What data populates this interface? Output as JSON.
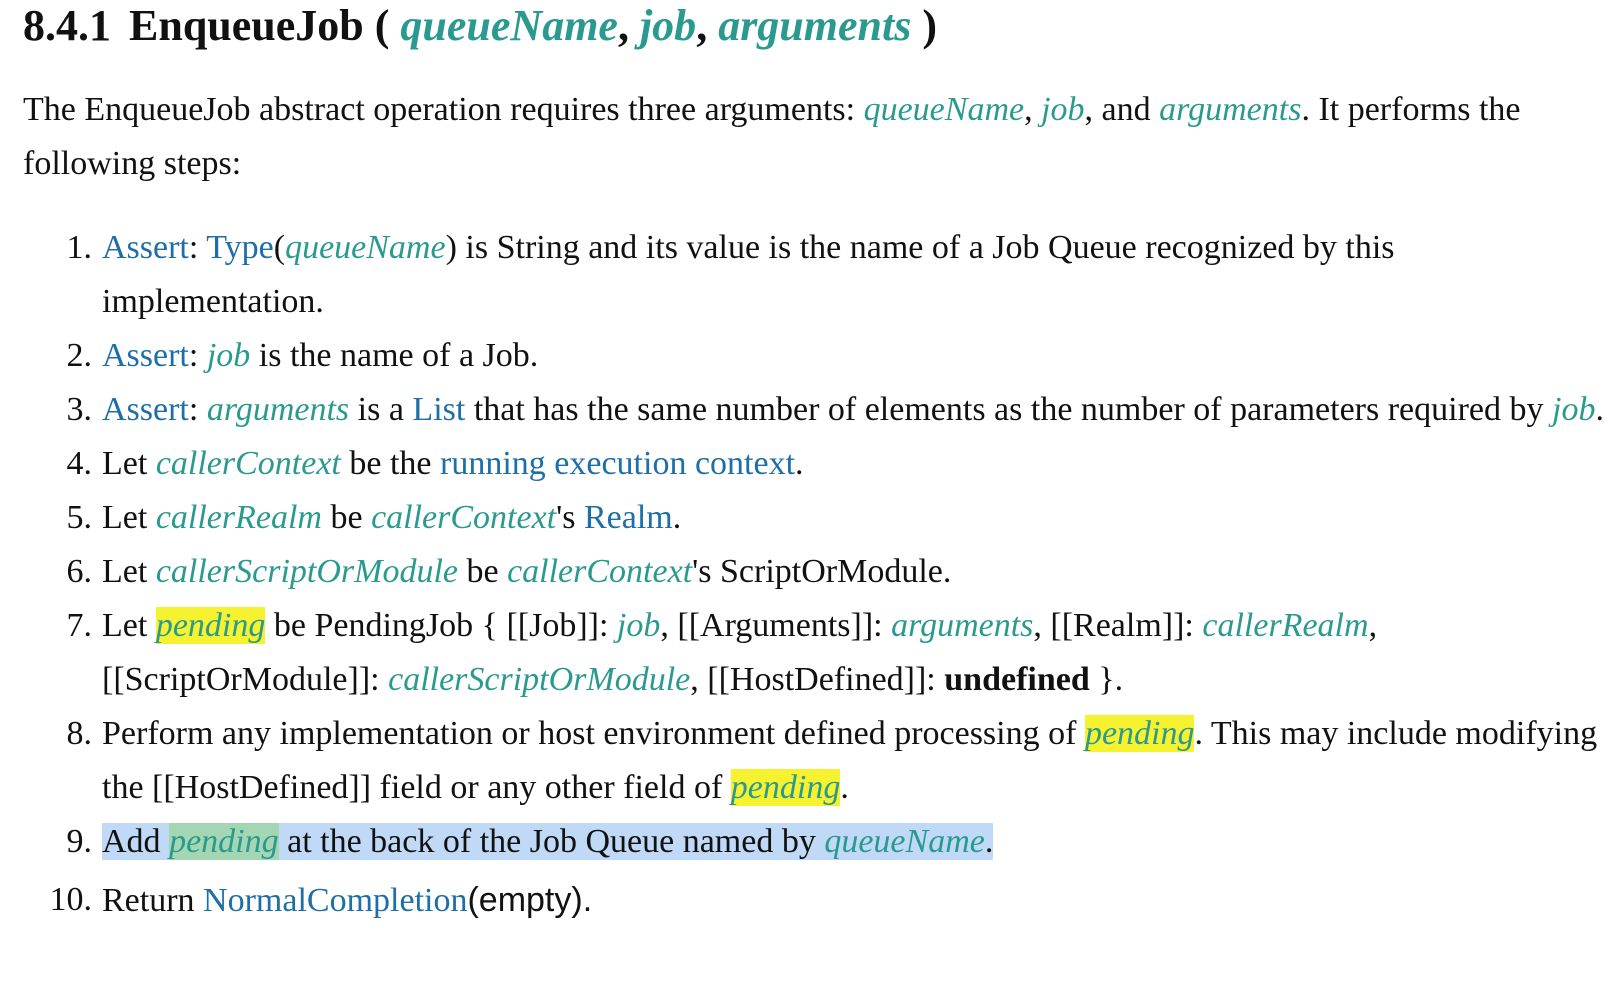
{
  "heading": {
    "number": "8.4.1",
    "name": "EnqueueJob",
    "open_paren": "(",
    "params": [
      "queueName",
      "job",
      "arguments"
    ],
    "close_paren": ")"
  },
  "intro": {
    "text1": "The EnqueueJob abstract operation requires three arguments: ",
    "var1": "queueName",
    "sep1": ", ",
    "var2": "job",
    "sep2": ", and ",
    "var3": "arguments",
    "text2": ". It performs the following steps:"
  },
  "steps": [
    {
      "marker": "1.",
      "assert": "Assert",
      "colon": ": ",
      "type_link": "Type",
      "open": "(",
      "var": "queueName",
      "close": ")",
      "rest": " is String and its value is the name of a Job Queue recognized by this implementation."
    },
    {
      "marker": "2.",
      "assert": "Assert",
      "colon": ": ",
      "var": "job",
      "rest": " is the name of a Job."
    },
    {
      "marker": "3.",
      "assert": "Assert",
      "colon": ": ",
      "var": "arguments",
      "mid": " is a ",
      "list_link": "List",
      "rest": " that has the same number of elements as the number of parameters required by ",
      "var2": "job",
      "end": "."
    },
    {
      "marker": "4.",
      "let": "Let ",
      "var": "callerContext",
      "mid": " be the ",
      "link": "running execution context",
      "end": "."
    },
    {
      "marker": "5.",
      "let": "Let ",
      "var": "callerRealm",
      "mid": " be ",
      "var2": "callerContext",
      "poss": "'s ",
      "link": "Realm",
      "end": "."
    },
    {
      "marker": "6.",
      "let": "Let ",
      "var": "callerScriptOrModule",
      "mid": " be ",
      "var2": "callerContext",
      "rest": "'s ScriptOrModule."
    },
    {
      "marker": "7.",
      "let": "Let ",
      "var": "pending",
      "t1": " be PendingJob { [[Job]]: ",
      "v_job": "job",
      "t2": ", [[Arguments]]: ",
      "v_args": "arguments",
      "t3": ", [[Realm]]: ",
      "v_realm": "callerRealm",
      "t4": ", [[ScriptOrModule]]: ",
      "v_som": "callerScriptOrModule",
      "t5": ", [[HostDefined]]: ",
      "undef": "undefined",
      "t6": " }."
    },
    {
      "marker": "8.",
      "t1": "Perform any implementation or host environment defined processing of ",
      "v1": "pending",
      "t2": ". This may include modifying the [[HostDefined]] field or any other field of ",
      "v2": "pending",
      "t3": "."
    },
    {
      "marker": "9.",
      "t1": "Add ",
      "v1": "pending",
      "t2": " at the back of the Job Queue named by ",
      "v2": "queueName",
      "t3": "."
    },
    {
      "marker": "10.",
      "t1": "Return ",
      "link": "NormalCompletion",
      "arg": "(empty)."
    }
  ],
  "colors": {
    "variable": "#2a9a8f",
    "link": "#1e6fa8",
    "highlight": "#f7f230",
    "selection": "#bfd9f6"
  }
}
